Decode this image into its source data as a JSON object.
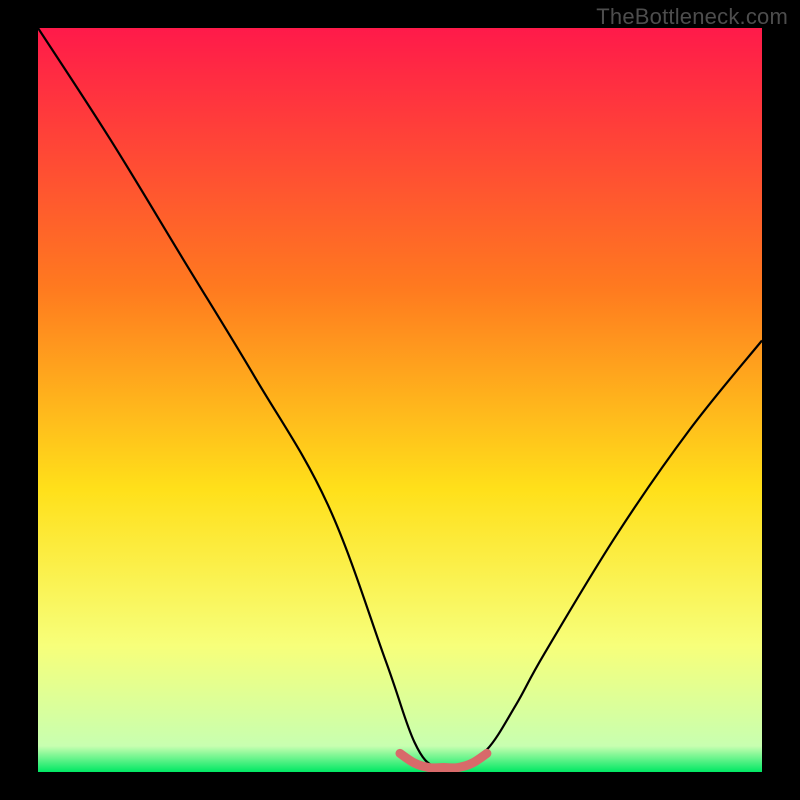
{
  "watermark": "TheBottleneck.com",
  "colors": {
    "frame_bg": "#000000",
    "gradient_top": "#ff1a4a",
    "gradient_mid1": "#ff7a1f",
    "gradient_mid2": "#ffe01a",
    "gradient_low": "#f7ff7a",
    "gradient_bottom": "#00e864",
    "curve": "#000000",
    "marker": "#d86a6a",
    "watermark_text": "#4d4d4d"
  },
  "chart_data": {
    "type": "line",
    "title": "",
    "xlabel": "",
    "ylabel": "",
    "xlim": [
      0,
      100
    ],
    "ylim": [
      0,
      100
    ],
    "series": [
      {
        "name": "bottleneck-curve",
        "x": [
          0,
          10,
          20,
          30,
          40,
          48,
          52,
          55,
          58,
          62,
          66,
          70,
          80,
          90,
          100
        ],
        "values": [
          100,
          85,
          69,
          53,
          36,
          15,
          4,
          0.5,
          0.5,
          3,
          9,
          16,
          32,
          46,
          58
        ]
      },
      {
        "name": "optimal-marker",
        "x": [
          50,
          52,
          54,
          56,
          58,
          60,
          62
        ],
        "values": [
          2.5,
          1.2,
          0.6,
          0.6,
          0.6,
          1.2,
          2.5
        ]
      }
    ],
    "gradient_stops": [
      {
        "pos": 0.0,
        "color": "#ff1a4a"
      },
      {
        "pos": 0.35,
        "color": "#ff7a1f"
      },
      {
        "pos": 0.62,
        "color": "#ffe01a"
      },
      {
        "pos": 0.83,
        "color": "#f7ff7a"
      },
      {
        "pos": 0.965,
        "color": "#c8ffb0"
      },
      {
        "pos": 1.0,
        "color": "#00e864"
      }
    ]
  }
}
